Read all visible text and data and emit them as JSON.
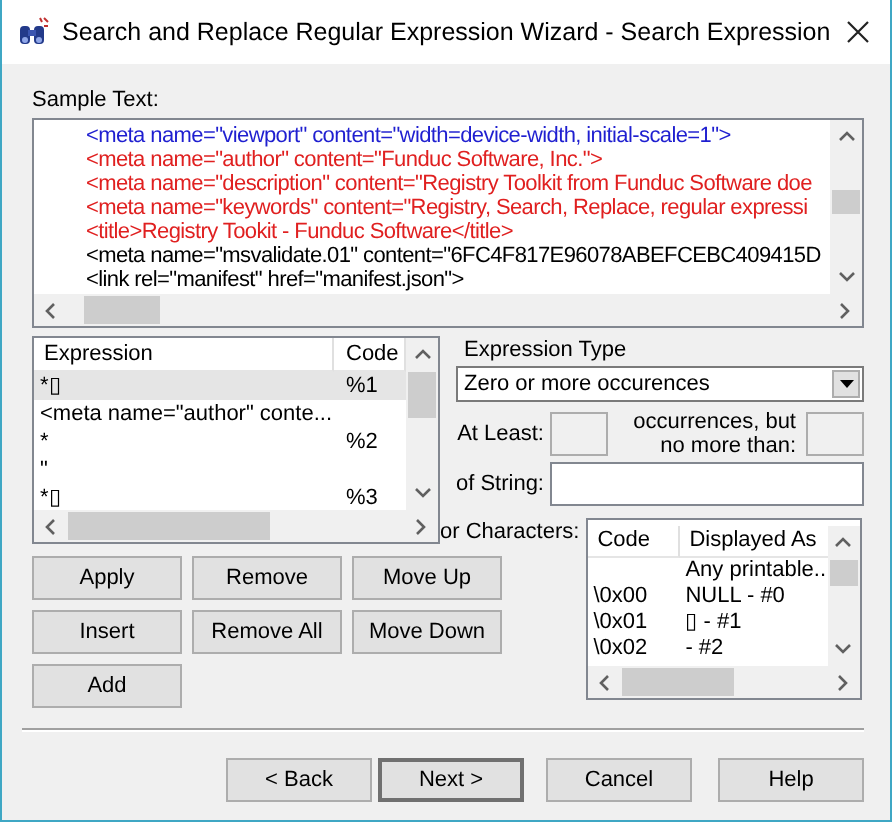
{
  "window": {
    "title": "Search and Replace Regular Expression Wizard - Search Expression"
  },
  "sample_text": {
    "label": "Sample Text:",
    "lines": [
      {
        "text": "<meta name=\"viewport\" content=\"width=device-width, initial-scale=1\">",
        "color": "#1f1fd0"
      },
      {
        "text": "<meta name=\"author\" content=\"Funduc Software, Inc.\">",
        "color": "#e02020"
      },
      {
        "text": "<meta name=\"description\" content=\"Registry Toolkit from Funduc Software doe",
        "color": "#e02020"
      },
      {
        "text": "<meta name=\"keywords\" content=\"Registry, Search, Replace, regular expressi",
        "color": "#e02020"
      },
      {
        "text": "<title>Registry Tookit - Funduc Software</title>",
        "color": "#e02020"
      },
      {
        "text": "<meta name=\"msvalidate.01\" content=\"6FC4F817E96078ABEFCEBC409415D",
        "color": "#000000"
      },
      {
        "text": "<link rel=\"manifest\" href=\"manifest.json\">",
        "color": "#000000"
      }
    ]
  },
  "expressions": {
    "columns": [
      "Expression",
      "Code"
    ],
    "rows": [
      {
        "expression": "*▯",
        "code": "%1",
        "selected": true
      },
      {
        "expression": "<meta name=\"author\" conte...",
        "code": "",
        "selected": false
      },
      {
        "expression": "*",
        "code": "%2",
        "selected": false
      },
      {
        "expression": "\"",
        "code": "",
        "selected": false
      },
      {
        "expression": "*▯",
        "code": "%3",
        "selected": false
      }
    ]
  },
  "edit_buttons": [
    "Apply",
    "Remove",
    "Move Up",
    "Insert",
    "Remove All",
    "Move Down",
    "Add"
  ],
  "expression_type": {
    "label": "Expression Type",
    "value": "Zero or more occurences"
  },
  "at_least": {
    "label": "At Least:",
    "disabled": true
  },
  "no_more_than": {
    "label": "occurrences, but no more than:",
    "disabled": true
  },
  "of_string": {
    "label": "of String:",
    "disabled": false
  },
  "characters": {
    "label": "or Characters:",
    "columns": [
      "Code",
      "Displayed As"
    ],
    "rows": [
      {
        "code": "",
        "displayed": "Any printable..."
      },
      {
        "code": "\\0x00",
        "displayed": "NULL - #0"
      },
      {
        "code": "\\0x01",
        "displayed": "▯ - #1"
      },
      {
        "code": "\\0x02",
        "displayed": " - #2"
      }
    ]
  },
  "nav_buttons": [
    {
      "label": "< Back",
      "default": false
    },
    {
      "label": "Next >",
      "default": true
    },
    {
      "label": "Cancel",
      "default": false
    },
    {
      "label": "Help",
      "default": false
    }
  ]
}
